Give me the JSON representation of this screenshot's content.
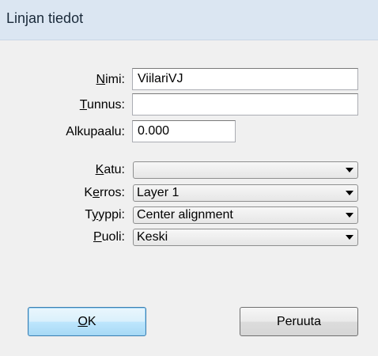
{
  "window": {
    "title": "Linjan tiedot"
  },
  "fields": {
    "nimi": {
      "label_accel": "N",
      "label_rest": "imi:",
      "value": "ViilariVJ"
    },
    "tunnus": {
      "label_accel": "T",
      "label_rest": "unnus:",
      "value": ""
    },
    "alkupaalu": {
      "label": "Alkupaalu:",
      "value": "0.000"
    }
  },
  "combos": {
    "katu": {
      "label_accel": "K",
      "label_rest": "atu:",
      "value": ""
    },
    "kerros": {
      "label_pre": "K",
      "label_accel": "e",
      "label_rest": "rros:",
      "value": "Layer 1"
    },
    "tyyppi": {
      "label_pre": "T",
      "label_accel": "y",
      "label_rest": "yppi:",
      "value": "Center alignment"
    },
    "puoli": {
      "label_accel": "P",
      "label_rest": "uoli:",
      "value": "Keski"
    }
  },
  "buttons": {
    "ok": {
      "accel": "O",
      "rest": "K"
    },
    "cancel": {
      "label": "Peruuta"
    }
  },
  "icons": {
    "combo_arrow": "chevron-down-icon"
  }
}
